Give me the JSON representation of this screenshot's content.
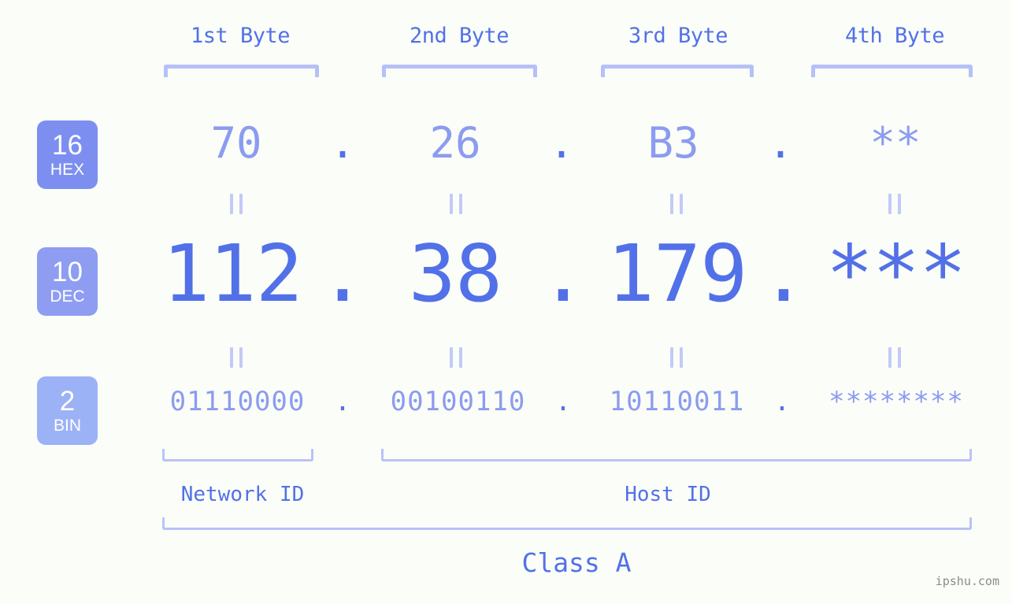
{
  "page": {
    "background_color": "#fbfdf8",
    "accent_color": "#5271e8",
    "accent_light_color": "#8b9cf0",
    "bracket_color": "#b6c0f8",
    "watermark": "ipshu.com"
  },
  "byte_headers": [
    {
      "label": "1st Byte"
    },
    {
      "label": "2nd Byte"
    },
    {
      "label": "3rd Byte"
    },
    {
      "label": "4th Byte"
    }
  ],
  "bases": [
    {
      "number": "16",
      "name": "HEX",
      "color": "#7c8ff0"
    },
    {
      "number": "10",
      "name": "DEC",
      "color": "#8e9df2"
    },
    {
      "number": "2",
      "name": "BIN",
      "color": "#9cb2f6"
    }
  ],
  "rows": {
    "hex": {
      "bytes": [
        "70",
        "26",
        "B3",
        "**"
      ],
      "separator": "."
    },
    "dec": {
      "bytes": [
        "112",
        "38",
        "179",
        "***"
      ],
      "separator": "."
    },
    "bin": {
      "bytes": [
        "01110000",
        "00100110",
        "10110011",
        "********"
      ],
      "separator": "."
    }
  },
  "equals_symbol": "=",
  "sections": [
    {
      "label": "Network ID"
    },
    {
      "label": "Host ID"
    }
  ],
  "class": {
    "label": "Class A"
  }
}
